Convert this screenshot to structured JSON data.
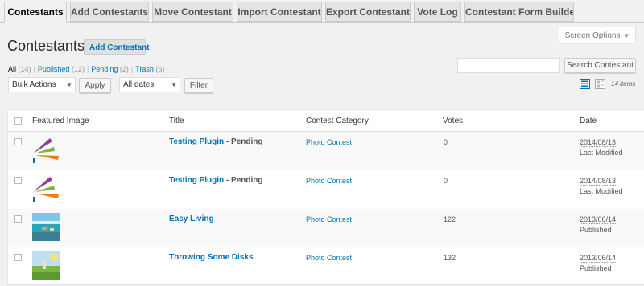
{
  "tabs": [
    {
      "label": "Contestants",
      "active": true
    },
    {
      "label": "Add Contestants"
    },
    {
      "label": "Move Contestant"
    },
    {
      "label": "Import Contestant"
    },
    {
      "label": "Export Contestant"
    },
    {
      "label": "Vote Log"
    },
    {
      "label": "Contestant Form Builder"
    }
  ],
  "header": {
    "title": "Contestants",
    "add_button": "Add Contestant",
    "screen_options": "Screen Options"
  },
  "filters": {
    "all": "All",
    "all_count": "(14)",
    "published": "Published",
    "published_count": "(12)",
    "pending": "Pending",
    "pending_count": "(2)",
    "trash": "Trash",
    "trash_count": "(6)"
  },
  "search": {
    "value": "",
    "button": "Search Contestant"
  },
  "bulk": {
    "selected": "Bulk Actions",
    "apply": "Apply"
  },
  "dates": {
    "selected": "All dates",
    "filter": "Filter"
  },
  "view": {
    "list_icon": "list-view-icon",
    "excerpt_icon": "excerpt-view-icon",
    "items_count": "14 items"
  },
  "table": {
    "columns": [
      "Featured Image",
      "Title",
      "Contest Category",
      "Votes",
      "Date"
    ],
    "rows": [
      {
        "title": "Testing Plugin",
        "state": " - Pending",
        "category": "Photo Contest",
        "votes": "0",
        "date": "2014/08/13",
        "date_status": "Last Modified",
        "thumb": "logo"
      },
      {
        "title": "Testing Plugin",
        "state": " - Pending",
        "category": "Photo Contest",
        "votes": "0",
        "date": "2014/08/13",
        "date_status": "Last Modified",
        "thumb": "logo"
      },
      {
        "title": "Easy Living",
        "state": "",
        "category": "Photo Contest",
        "votes": "122",
        "date": "2013/06/14",
        "date_status": "Published",
        "thumb": "beach"
      },
      {
        "title": "Throwing Some Disks",
        "state": "",
        "category": "Photo Contest",
        "votes": "132",
        "date": "2013/06/14",
        "date_status": "Published",
        "thumb": "field"
      }
    ]
  },
  "colors": {
    "link": "#0073aa",
    "background": "#f1f1f1"
  }
}
